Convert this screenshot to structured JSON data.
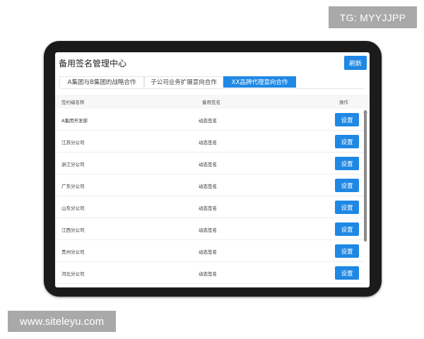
{
  "watermarks": {
    "top": "TG: MYYJJPP",
    "bottom": "www.siteleyu.com"
  },
  "header": {
    "title": "备用签名管理中心",
    "refresh_label": "刷新"
  },
  "tabs": [
    {
      "label": "A集团与B集团的战略合作",
      "active": false
    },
    {
      "label": "子公司业务扩展意向合作",
      "active": false
    },
    {
      "label": "XX品牌代理意向合作",
      "active": true
    }
  ],
  "table": {
    "columns": [
      "签约编名称",
      "备用签名",
      "操作"
    ],
    "rows": [
      {
        "name": "A集团开发部",
        "signature": "动态签名",
        "action": "设置"
      },
      {
        "name": "江苏分公司",
        "signature": "动态签名",
        "action": "设置"
      },
      {
        "name": "浙江分公司",
        "signature": "动态签名",
        "action": "设置"
      },
      {
        "name": "广东分公司",
        "signature": "动态签名",
        "action": "设置"
      },
      {
        "name": "山东分公司",
        "signature": "动态签名",
        "action": "设置"
      },
      {
        "name": "江西分公司",
        "signature": "动态签名",
        "action": "设置"
      },
      {
        "name": "贵州分公司",
        "signature": "动态签名",
        "action": "设置"
      },
      {
        "name": "河北分公司",
        "signature": "动态签名",
        "action": "设置"
      }
    ]
  },
  "colors": {
    "accent": "#1f88e5",
    "bezel": "#1b1b1b",
    "watermark_bg": "#a9a9a9"
  }
}
